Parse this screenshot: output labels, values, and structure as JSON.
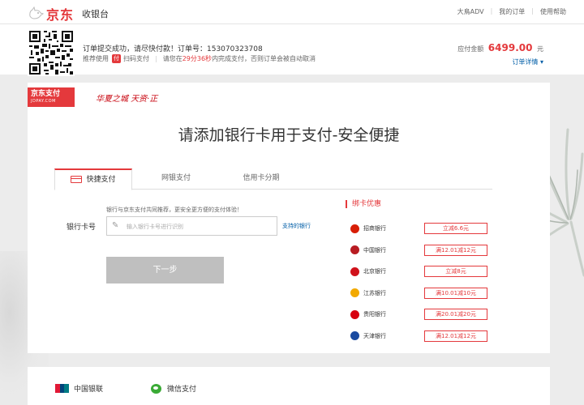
{
  "header": {
    "brand": "京东",
    "cashier": "收银台",
    "links": [
      "大鳥ADV",
      "我的订单",
      "使用帮助"
    ]
  },
  "order": {
    "message": "订单提交成功，请尽快付款！订单号：153070323708",
    "recommend_label": "推荐使用",
    "scan_label": "扫码支付",
    "timer_prefix": "请您在",
    "timer": "29分36秒",
    "timer_suffix": "内完成支付，否则订单会被自动取消",
    "amount_label": "应付金额",
    "amount": "6499.00",
    "currency": "元",
    "detail_link": "订单详情 ▾"
  },
  "panel": {
    "badge_cn": "京东支付",
    "badge_en": "JDPAY.COM",
    "slogan": "华夏之城 天资·正",
    "title": "请添加银行卡用于支付-安全便捷",
    "tabs": [
      {
        "label": "快捷支付",
        "active": true
      },
      {
        "label": "网银支付",
        "active": false
      },
      {
        "label": "信用卡分期",
        "active": false
      }
    ],
    "hint": "银行与京东支付共同推荐，更安全更方便的支付体验！",
    "card_label": "银行卡号",
    "card_placeholder": "输入银行卡号进行识别",
    "support_link": "支持的银行",
    "next_button": "下一步"
  },
  "promotions": {
    "title": "绑卡优惠",
    "banks": [
      {
        "name": "招商银行",
        "offer": "立减6.6元",
        "color": "#d81e06"
      },
      {
        "name": "中国银行",
        "offer": "满12.01减12元",
        "color": "#b81c22"
      },
      {
        "name": "北京银行",
        "offer": "立减8元",
        "color": "#d0121b"
      },
      {
        "name": "江苏银行",
        "offer": "满10.01减10元",
        "color": "#f2a900"
      },
      {
        "name": "贵阳银行",
        "offer": "满20.01减20元",
        "color": "#d7000f"
      },
      {
        "name": "天津银行",
        "offer": "满12.01减12元",
        "color": "#1a4aa0"
      }
    ]
  },
  "payment_options": {
    "unionpay": "中国银联",
    "wechat": "微信支付"
  },
  "colors": {
    "accent": "#e4393c",
    "link": "#005ea7",
    "disabled_button": "#bfbfbf"
  }
}
